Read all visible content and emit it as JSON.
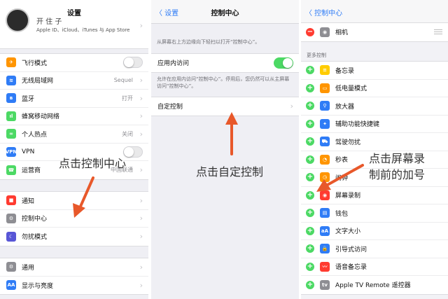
{
  "panel1": {
    "profile": {
      "title": "设置",
      "name": "开 住 子",
      "subtitle": "Apple ID、iCloud、iTunes 与 App Store"
    },
    "group1": [
      {
        "label": "飞行模式",
        "icon": "airplane-icon",
        "color": "#ff9500",
        "glyph": "✈",
        "toggle": false
      },
      {
        "label": "无线局域网",
        "icon": "wifi-icon",
        "color": "#2f7cf6",
        "glyph": "≋",
        "value": "Sequel"
      },
      {
        "label": "蓝牙",
        "icon": "bluetooth-icon",
        "color": "#2f7cf6",
        "glyph": "ʙ",
        "value": "打开"
      },
      {
        "label": "蜂窝移动网络",
        "icon": "cellular-icon",
        "color": "#4cd964",
        "glyph": "ıl"
      },
      {
        "label": "个人热点",
        "icon": "hotspot-icon",
        "color": "#4cd964",
        "glyph": "∞",
        "value": "关闭"
      },
      {
        "label": "VPN",
        "icon": "vpn-icon",
        "color": "#2f7cf6",
        "glyph": "VPN",
        "toggle": false
      },
      {
        "label": "运营商",
        "icon": "carrier-icon",
        "color": "#4cd964",
        "glyph": "☎",
        "value": "中国联通"
      }
    ],
    "group2": [
      {
        "label": "通知",
        "icon": "notifications-icon",
        "color": "#ff3b30",
        "glyph": "■"
      },
      {
        "label": "控制中心",
        "icon": "control-center-icon",
        "color": "#8e8e93",
        "glyph": "⚙"
      },
      {
        "label": "勿扰模式",
        "icon": "moon-icon",
        "color": "#5856d6",
        "glyph": "☾"
      }
    ],
    "group3": [
      {
        "label": "通用",
        "icon": "gear-icon",
        "color": "#8e8e93",
        "glyph": "⚙"
      },
      {
        "label": "显示与亮度",
        "icon": "display-icon",
        "color": "#2f7cf6",
        "glyph": "AA"
      }
    ],
    "annotation": "点击控制中心"
  },
  "panel2": {
    "back": "〈 设置",
    "title": "控制中心",
    "intro": "从屏幕右上方边缘向下轻扫以打开“控制中心”。",
    "access_label": "应用内访问",
    "access_toggle": true,
    "access_desc": "允许在应用内访问“控制中心”。停用后，您仍然可以从主屏幕访问“控制中心”。",
    "customize_label": "自定控制",
    "annotation": "点击自定控制"
  },
  "panel3": {
    "back": "〈 控制中心",
    "included": [
      {
        "label": "相机",
        "icon": "camera-icon",
        "color": "#8e8e93",
        "glyph": "◉"
      }
    ],
    "more_header": "更多控制",
    "more": [
      {
        "label": "备忘录",
        "icon": "notes-icon",
        "color": "#ffcc00",
        "glyph": "≡"
      },
      {
        "label": "低电量模式",
        "icon": "battery-icon",
        "color": "#ff9500",
        "glyph": "▭"
      },
      {
        "label": "放大器",
        "icon": "magnifier-icon",
        "color": "#2f7cf6",
        "glyph": "⚲"
      },
      {
        "label": "辅助功能快捷键",
        "icon": "accessibility-icon",
        "color": "#2f7cf6",
        "glyph": "✦"
      },
      {
        "label": "驾驶勿扰",
        "icon": "car-icon",
        "color": "#2f7cf6",
        "glyph": "⛟"
      },
      {
        "label": "秒表",
        "icon": "stopwatch-icon",
        "color": "#ff9500",
        "glyph": "◔"
      },
      {
        "label": "闹钟",
        "icon": "alarm-icon",
        "color": "#ff9500",
        "glyph": "◷"
      },
      {
        "label": "屏幕录制",
        "icon": "screen-record-icon",
        "color": "#ff3b30",
        "glyph": "◉"
      },
      {
        "label": "钱包",
        "icon": "wallet-icon",
        "color": "#2f7cf6",
        "glyph": "▤"
      },
      {
        "label": "文字大小",
        "icon": "text-size-icon",
        "color": "#2f7cf6",
        "glyph": "aA"
      },
      {
        "label": "引导式访问",
        "icon": "guided-access-icon",
        "color": "#2f7cf6",
        "glyph": "🔒"
      },
      {
        "label": "语音备忘录",
        "icon": "voice-memo-icon",
        "color": "#ff3b30",
        "glyph": "〰"
      },
      {
        "label": "Apple TV Remote 遥控器",
        "icon": "tv-remote-icon",
        "color": "#8e8e93",
        "glyph": "tv"
      }
    ],
    "annotation_line1": "点击屏幕录",
    "annotation_line2": "制前的加号"
  },
  "colors": {
    "accent": "#2f7cf6",
    "arrow": "#e8582a",
    "toggle_on": "#4cd964"
  }
}
